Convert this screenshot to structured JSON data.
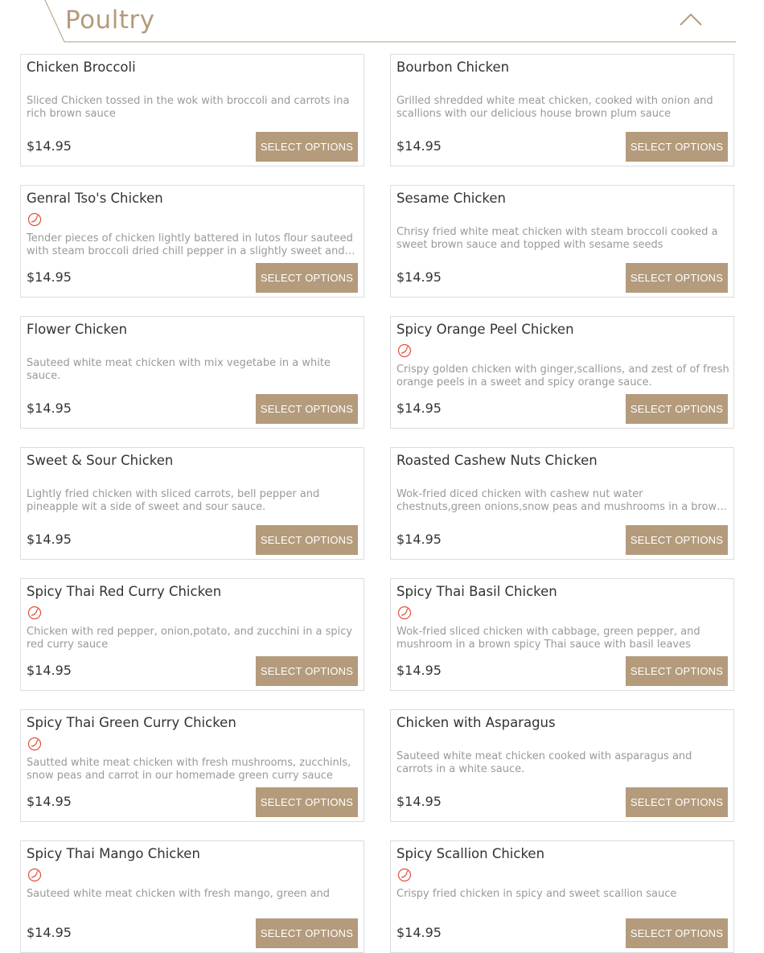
{
  "section": {
    "title": "Poultry",
    "collapse_icon": "chevron-up-icon",
    "accent_color": "#b49b7c"
  },
  "spicy_icon": "chili-pepper-icon",
  "items": [
    {
      "name": "Chicken Broccoli",
      "spicy": false,
      "description": "Sliced Chicken tossed in the wok with broccoli and carrots ina rich brown sauce",
      "price": "$14.95",
      "button": "SELECT OPTIONS"
    },
    {
      "name": "Bourbon Chicken",
      "spicy": false,
      "description": "Grilled shredded white meat chicken, cooked with onion and scallions with our delicious house brown plum sauce",
      "price": "$14.95",
      "button": "SELECT OPTIONS"
    },
    {
      "name": "Genral Tso's Chicken",
      "spicy": true,
      "description": "Tender pieces of chicken lightly battered in lutos flour sauteed with steam broccoli dried chill pepper in a slightly sweet and spicy sauce",
      "price": "$14.95",
      "button": "SELECT OPTIONS"
    },
    {
      "name": "Sesame Chicken",
      "spicy": false,
      "description": "Chrisy fried white meat chicken with steam broccoli cooked a sweet brown sauce and topped with sesame seeds",
      "price": "$14.95",
      "button": "SELECT OPTIONS"
    },
    {
      "name": "Flower Chicken",
      "spicy": false,
      "description": "Sauteed white meat chicken with mix vegetabe in a white sauce.",
      "price": "$14.95",
      "button": "SELECT OPTIONS"
    },
    {
      "name": "Spicy Orange Peel Chicken",
      "spicy": true,
      "description": "Crispy golden chicken with ginger,scallions, and zest of of fresh orange peels in a sweet and spicy orange sauce.",
      "price": "$14.95",
      "button": "SELECT OPTIONS"
    },
    {
      "name": "Sweet & Sour Chicken",
      "spicy": false,
      "description": "Lightly fried chicken with sliced carrots, bell pepper and pineapple wit a side of sweet and sour sauce.",
      "price": "$14.95",
      "button": "SELECT OPTIONS"
    },
    {
      "name": "Roasted Cashew Nuts Chicken",
      "spicy": false,
      "description": "Wok-fried diced chicken with cashew nut water chestnuts,green onions,snow peas and mushrooms in a brown sauce",
      "price": "$14.95",
      "button": "SELECT OPTIONS"
    },
    {
      "name": "Spicy Thai Red Curry Chicken",
      "spicy": true,
      "description": "Chicken with red pepper, onion,potato, and zucchini in a spicy red curry sauce",
      "price": "$14.95",
      "button": "SELECT OPTIONS"
    },
    {
      "name": "Spicy Thai Basil Chicken",
      "spicy": true,
      "description": "Wok-fried sliced chicken with cabbage, green pepper, and mushroom in a brown spicy Thai sauce with basil leaves",
      "price": "$14.95",
      "button": "SELECT OPTIONS"
    },
    {
      "name": "Spicy Thai Green Curry Chicken",
      "spicy": true,
      "description": "Sautted white meat chicken with fresh mushrooms, zucchinls, snow peas and carrot in our homemade green curry sauce",
      "price": "$14.95",
      "button": "SELECT OPTIONS"
    },
    {
      "name": "Chicken with Asparagus",
      "spicy": false,
      "description": "Sauteed white meat chicken cooked with asparagus and carrots in a white sauce.",
      "price": "$14.95",
      "button": "SELECT OPTIONS"
    },
    {
      "name": "Spicy Thai Mango Chicken",
      "spicy": true,
      "description": "Sauteed white meat chicken with fresh mango, green and",
      "price": "$14.95",
      "button": "SELECT OPTIONS"
    },
    {
      "name": "Spicy Scallion Chicken",
      "spicy": true,
      "description": "Crispy fried chicken in spicy and sweet scallion sauce",
      "price": "$14.95",
      "button": "SELECT OPTIONS"
    }
  ]
}
